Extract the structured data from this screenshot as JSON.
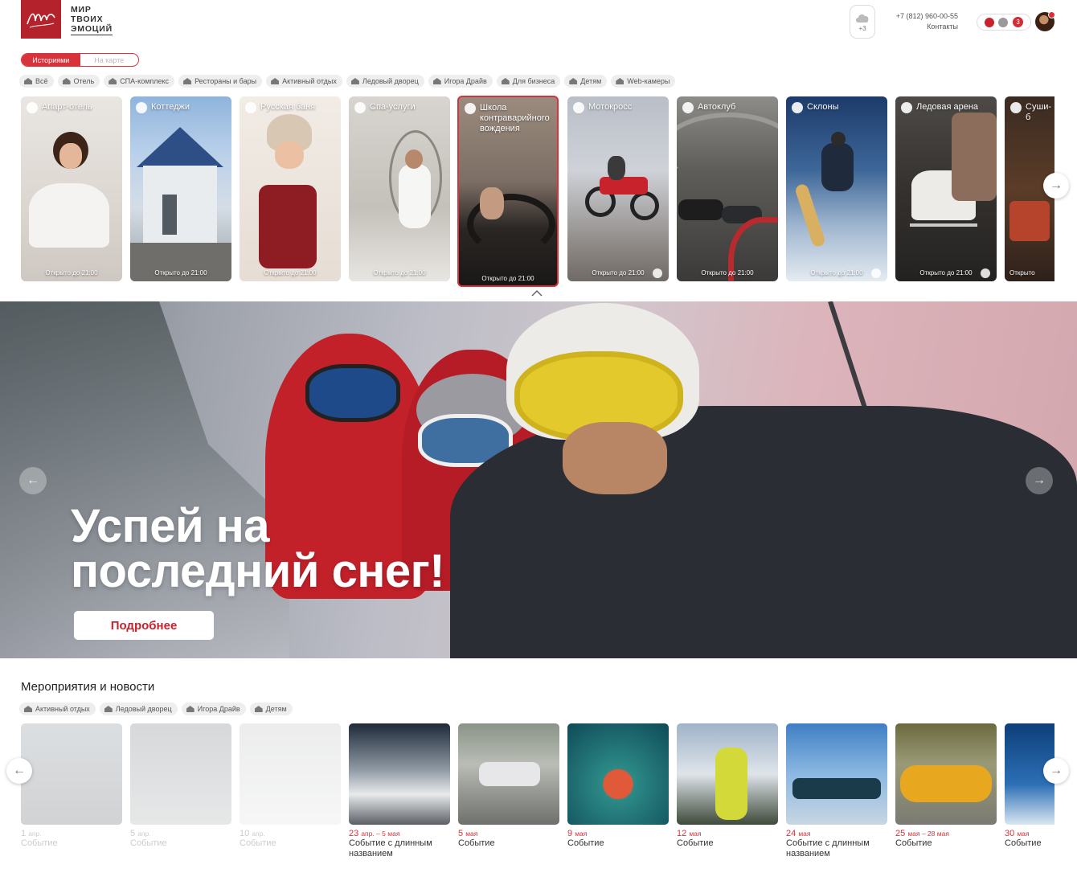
{
  "header": {
    "logo_text": [
      "МИР",
      "ТВОИХ",
      "ЭМОЦИЙ"
    ],
    "weather": "+3",
    "phone": "+7 (812) 960-00-55",
    "contacts_label": "Контакты",
    "notification_count": "3"
  },
  "view_toggle": {
    "active": "Историями",
    "inactive": "На карте"
  },
  "categories": [
    {
      "label": "Всё"
    },
    {
      "label": "Отель"
    },
    {
      "label": "СПА-комплекс"
    },
    {
      "label": "Рестораны и бары"
    },
    {
      "label": "Активный отдых"
    },
    {
      "label": "Ледовый дворец"
    },
    {
      "label": "Игора Драйв"
    },
    {
      "label": "Для бизнеса"
    },
    {
      "label": "Детям"
    },
    {
      "label": "Web-камеры"
    }
  ],
  "stories": [
    {
      "title": "Апарт-отель",
      "hours": "Открыто до 21:00"
    },
    {
      "title": "Коттеджи",
      "hours": "Открыто до 21:00"
    },
    {
      "title": "Русская баня",
      "hours": "Открыто до 21:00"
    },
    {
      "title": "Спа-услуги",
      "hours": "Открыто до 21:00"
    },
    {
      "title": "Школа контраварийного вождения",
      "hours": "Открыто до 21:00"
    },
    {
      "title": "Мотокросс",
      "hours": "Открыто до 21:00"
    },
    {
      "title": "Автоклуб",
      "hours": "Открыто до 21:00"
    },
    {
      "title": "Склоны",
      "hours": "Открыто до 21:00"
    },
    {
      "title": "Ледовая арена",
      "hours": "Открыто до 21:00"
    },
    {
      "title": "Суши-б",
      "hours": "Открыто"
    }
  ],
  "hero": {
    "title_line1": "Успей на",
    "title_line2": "последний снег!",
    "button": "Подробнее"
  },
  "events_section": {
    "title": "Мероприятия и новости",
    "filters": [
      {
        "label": "Активный отдых"
      },
      {
        "label": "Ледовый дворец"
      },
      {
        "label": "Игора Драйв"
      },
      {
        "label": "Детям"
      }
    ],
    "items": [
      {
        "day": "1",
        "month": "апр.",
        "name": "Событие"
      },
      {
        "day": "5",
        "month": "апр.",
        "name": "Событие"
      },
      {
        "day": "10",
        "month": "апр.",
        "name": "Событие"
      },
      {
        "day": "23",
        "month": "апр. – 5 мая",
        "name": "Событие с длинным названием"
      },
      {
        "day": "5",
        "month": "мая",
        "name": "Событие"
      },
      {
        "day": "9",
        "month": "мая",
        "name": "Событие"
      },
      {
        "day": "12",
        "month": "мая",
        "name": "Событие"
      },
      {
        "day": "24",
        "month": "мая",
        "name": "Событие с длинным названием"
      },
      {
        "day": "25",
        "month": "мая – 28 мая",
        "name": "Событие"
      },
      {
        "day": "30",
        "month": "мая",
        "name": "Событие"
      }
    ]
  },
  "colors": {
    "accent": "#d8323a",
    "brand": "#b4232c"
  }
}
